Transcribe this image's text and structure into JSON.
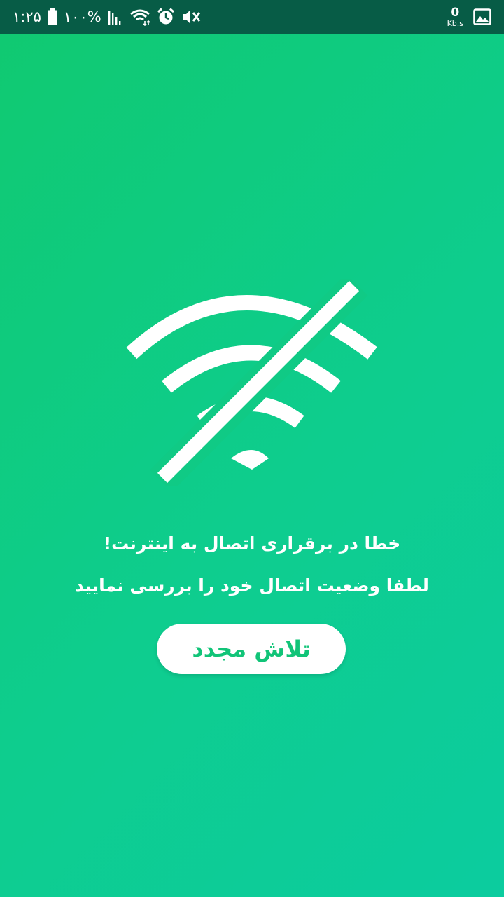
{
  "status_bar": {
    "time": "۱:۲۵",
    "battery_percent": "۱۰۰%",
    "net_speed_value": "0",
    "net_speed_unit": "Kb.s",
    "icons": [
      "battery-icon",
      "signal-icon",
      "wifi-icon",
      "alarm-icon",
      "mute-icon",
      "image-icon"
    ]
  },
  "main": {
    "icon": "wifi-off-icon",
    "error_title": "خطا در برقراری اتصال به اینترنت!",
    "error_subtitle": "لطفا وضعیت اتصال خود را بررسی نمایید",
    "retry_label": "تلاش مجدد"
  },
  "colors": {
    "status_bar": "#075c46",
    "gradient_start": "#10c970",
    "gradient_end": "#0ccc9f",
    "button_bg": "#ffffff",
    "button_text": "#11c478"
  }
}
